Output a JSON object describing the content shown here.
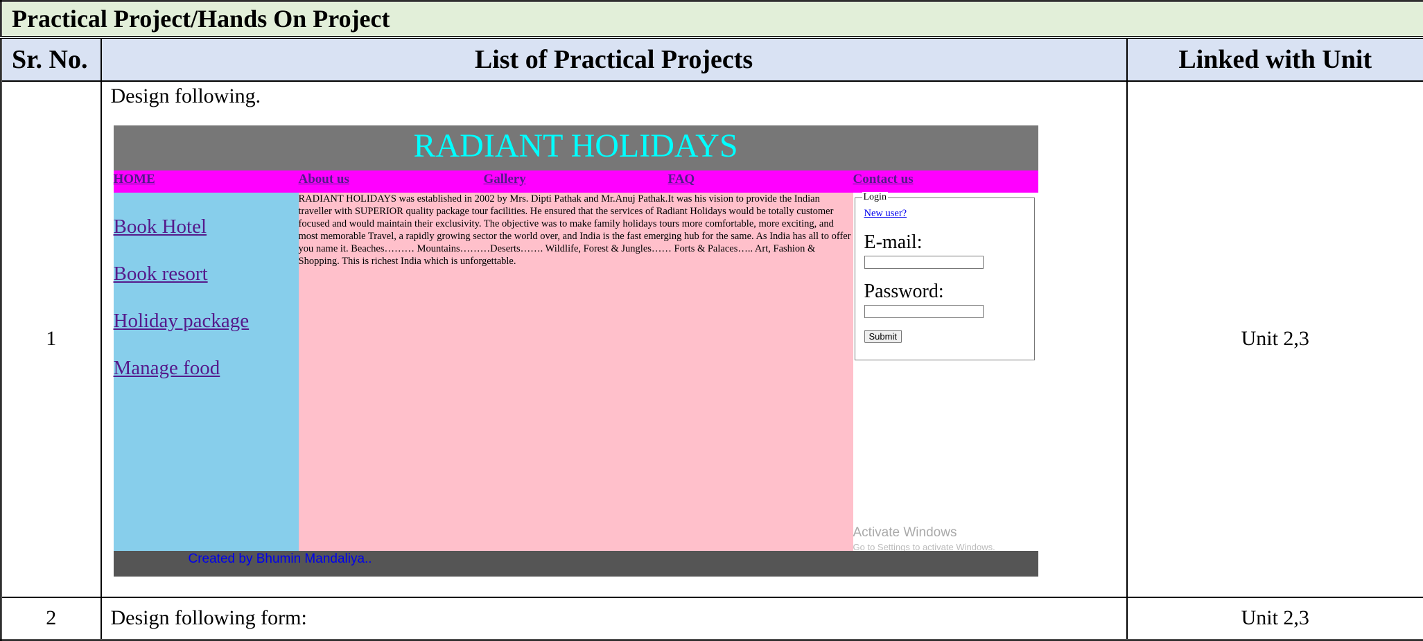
{
  "table": {
    "title": "Practical Project/Hands On Project",
    "headers": {
      "sr_no": "Sr. No.",
      "list": "List of Practical Projects",
      "linked": "Linked with Unit"
    },
    "rows": [
      {
        "sr": "1",
        "description": "Design following.",
        "unit": "Unit 2,3"
      },
      {
        "sr": "2",
        "description": "Design following form:",
        "unit": "Unit 2,3"
      }
    ]
  },
  "site": {
    "header_title": "RADIANT HOLIDAYS",
    "nav": [
      "HOME",
      "About us",
      "Gallery",
      "FAQ",
      "Contact us"
    ],
    "left_links": [
      "Book Hotel",
      "Book resort",
      "Holiday package",
      "Manage food"
    ],
    "main_text": "RADIANT HOLIDAYS was established in 2002 by Mrs. Dipti Pathak and Mr.Anuj Pathak.It was his vision to provide the Indian traveller with SUPERIOR quality package tour facilities. He ensured that the services of Radiant Holidays would be totally customer focused and would maintain their exclusivity. The objective was to make family holidays tours more comfortable, more exciting, and most memorable Travel, a rapidly growing sector the world over, and India is the fast emerging hub for the same. As India has all to offer you name it. Beaches……… Mountains………Deserts……. Wildlife, Forest & Jungles…… Forts & Palaces….. Art, Fashion & Shopping. This is richest India which is unforgettable.",
    "login": {
      "legend": "Login",
      "new_user": "New user?",
      "email_label": "E-mail:",
      "password_label": "Password:",
      "submit": "Submit"
    },
    "watermark": {
      "line1": "Activate Windows",
      "line2": "Go to Settings to activate Windows."
    },
    "footer": "Created by Bhumin Mandaliya..",
    "colors": {
      "header_bg": "#777777",
      "header_text": "#00ffff",
      "nav_bg": "#ff00ff",
      "left_bg": "#87ceeb",
      "main_bg": "#ffc0cb",
      "footer_bg": "#555555"
    }
  }
}
